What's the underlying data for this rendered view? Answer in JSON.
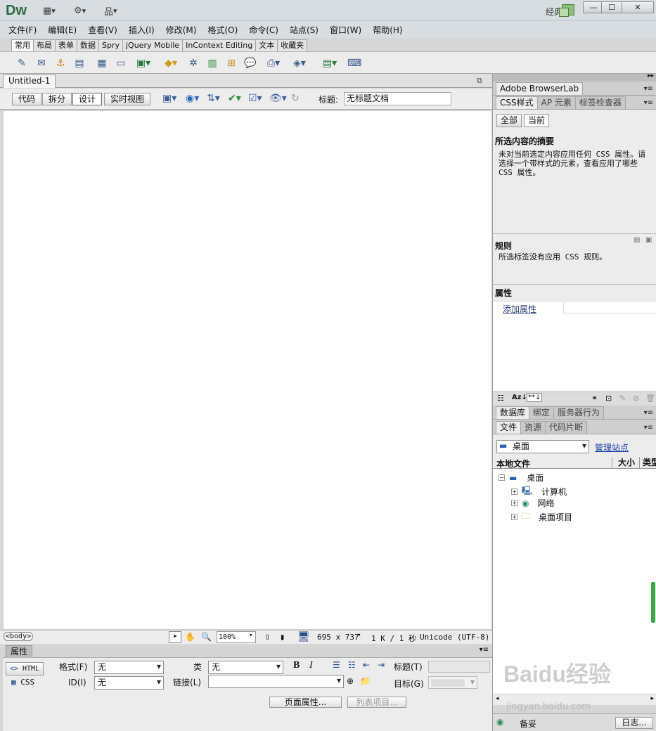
{
  "titlebar": {
    "logo": "Dw",
    "workspace": "经典",
    "minimize": "—",
    "maximize": "☐",
    "close": "✕"
  },
  "menu": [
    "文件(F)",
    "编辑(E)",
    "查看(V)",
    "插入(I)",
    "修改(M)",
    "格式(O)",
    "命令(C)",
    "站点(S)",
    "窗口(W)",
    "帮助(H)"
  ],
  "insert_tabs": [
    "常用",
    "布局",
    "表单",
    "数据",
    "Spry",
    "jQuery Mobile",
    "InContext Editing",
    "文本",
    "收藏夹"
  ],
  "document": {
    "tab": "Untitled-1",
    "views": [
      "代码",
      "拆分",
      "设计",
      "实时视图"
    ],
    "active_view": "设计",
    "title_label": "标题:",
    "title_value": "无标题文档"
  },
  "statusbar": {
    "tag": "<body>",
    "zoom": "100%",
    "size": "695 x 737",
    "download": "1 K / 1 秒",
    "encoding": "Unicode (UTF-8)"
  },
  "properties": {
    "header": "属性",
    "html_btn": "HTML",
    "css_btn": "CSS",
    "format_label": "格式(F)",
    "format_value": "无",
    "id_label": "ID(I)",
    "id_value": "无",
    "class_label": "类",
    "class_value": "无",
    "link_label": "链接(L)",
    "title_label": "标题(T)",
    "target_label": "目标(G)",
    "page_props": "页面属性...",
    "list_item": "列表项目..."
  },
  "right_panel": {
    "browserlab_tab": "Adobe BrowserLab",
    "css_tabs": [
      "CSS样式",
      "AP 元素",
      "标签检查器"
    ],
    "mode_buttons": [
      "全部",
      "当前"
    ],
    "summary_title": "所选内容的摘要",
    "summary_text": "未对当前选定内容应用任何 CSS 属性。请选择一个带样式的元素，查看应用了哪些 CSS 属性。",
    "rules_title": "规则",
    "rules_text": "所选标签没有应用 CSS 规则。",
    "props_title": "属性",
    "add_prop": "添加属性",
    "db_tabs": [
      "数据库",
      "绑定",
      "服务器行为"
    ],
    "file_tabs": [
      "文件",
      "资源",
      "代码片断"
    ],
    "site_select": "桌面",
    "manage_sites": "管理站点",
    "columns": [
      "本地文件",
      "大小",
      "类型"
    ],
    "tree_root": "桌面",
    "tree_items": [
      "计算机",
      "网络",
      "桌面项目"
    ],
    "status_ready": "备妥",
    "log_btn": "日志..."
  },
  "watermark": {
    "brand": "Baidu经验",
    "url": "jingyan.baidu.com"
  }
}
